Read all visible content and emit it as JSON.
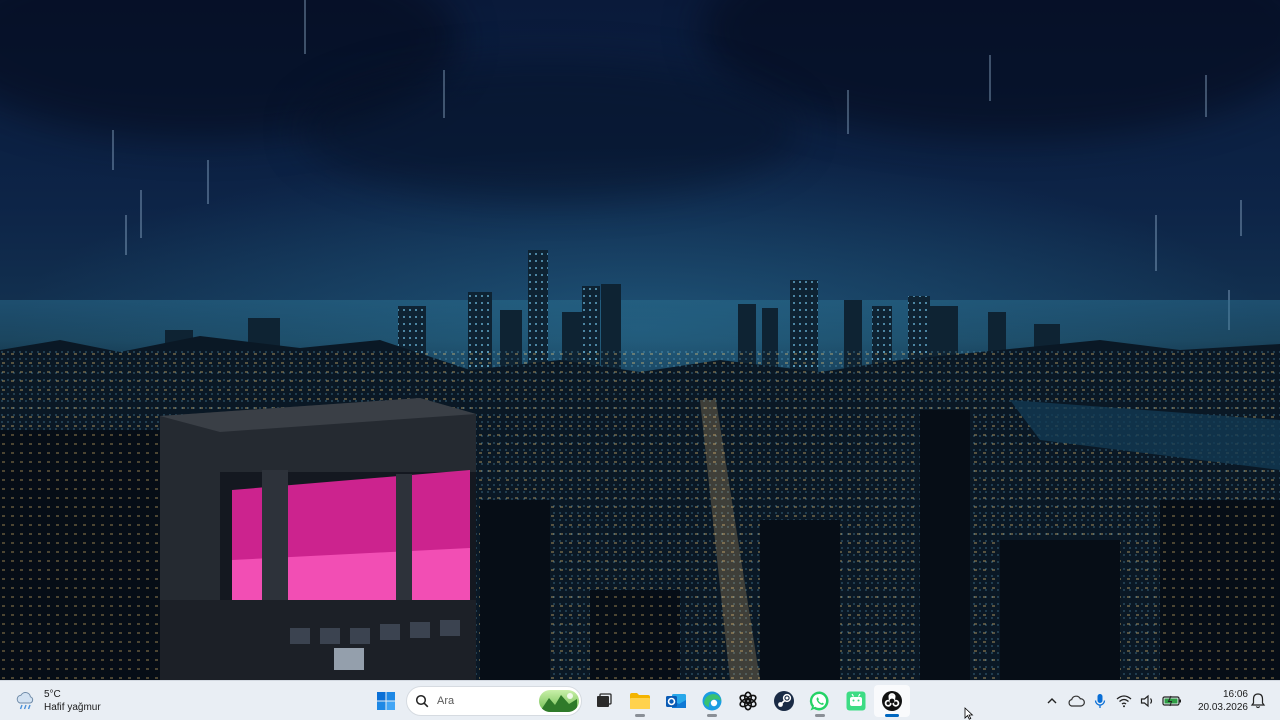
{
  "taskbar": {
    "weather": {
      "temperature": "5°C",
      "condition": "Hafif yağmur",
      "icon": "rain-cloud-icon"
    },
    "start": {
      "icon": "windows-start-icon"
    },
    "search": {
      "label": "Ara",
      "icon": "search-icon"
    },
    "pinned_apps": [
      {
        "name": "task-view",
        "icon": "task-view-icon"
      },
      {
        "name": "file-explorer",
        "icon": "folder-icon"
      },
      {
        "name": "outlook",
        "icon": "outlook-icon"
      },
      {
        "name": "edge",
        "icon": "edge-browser-icon"
      },
      {
        "name": "chatgpt",
        "icon": "chatgpt-icon"
      },
      {
        "name": "steam",
        "icon": "steam-icon"
      },
      {
        "name": "whatsapp",
        "icon": "whatsapp-icon"
      },
      {
        "name": "android-app",
        "icon": "android-icon"
      },
      {
        "name": "obs",
        "icon": "obs-studio-icon",
        "active": true
      }
    ],
    "tray": {
      "icons": [
        "chevron-up-icon",
        "onedrive-cloud-icon",
        "microphone-icon",
        "wifi-icon",
        "speaker-icon",
        "battery-icon"
      ],
      "time": "16:06",
      "date": "20.03.2026",
      "notification_icon": "notification-bell-icon"
    }
  },
  "colors": {
    "taskbar_bg": "#e9eef4",
    "accent": "#0067c0",
    "neon_pink": "#e0259a",
    "sky_top": "#0a1a3a"
  }
}
